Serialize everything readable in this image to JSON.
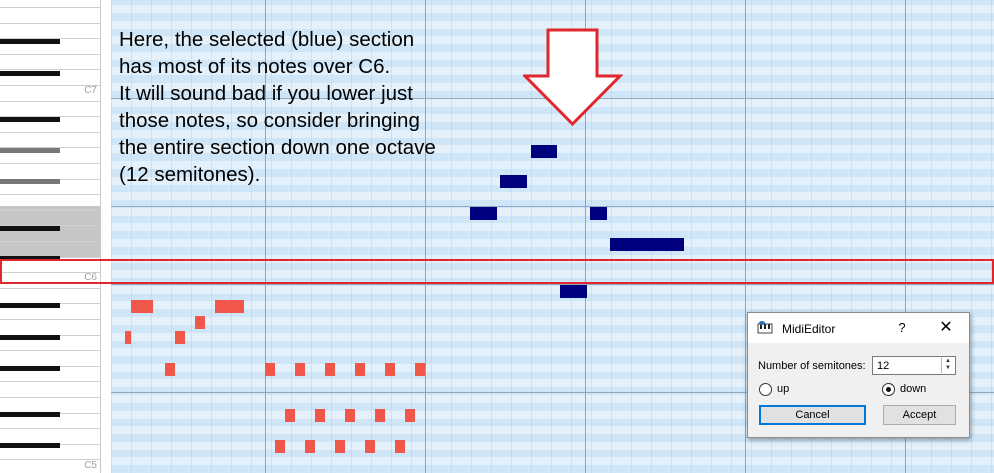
{
  "piano": {
    "octave_labels": [
      "C7",
      "C6",
      "C5"
    ]
  },
  "annotation": {
    "lines": [
      "Here, the selected (blue) section",
      "has most of its notes over C6.",
      "It will sound bad if you lower just",
      "those notes, so consider bringing",
      "the entire section down one octave",
      "(12 semitones)."
    ],
    "arrow_color": "#e0262e",
    "highlight_color": "#e0262e"
  },
  "notes": {
    "selected_color": "#00007e",
    "unselected_color": "#f0564a"
  },
  "dialog": {
    "title": "MidiEditor",
    "help_symbol": "?",
    "close_symbol": "✕",
    "semitones_label": "Number of semitones:",
    "semitones_value": "12",
    "direction_options": [
      {
        "label": "up",
        "selected": false
      },
      {
        "label": "down",
        "selected": true
      }
    ],
    "cancel_label": "Cancel",
    "accept_label": "Accept",
    "app_icon": "midieditor-app-icon"
  }
}
